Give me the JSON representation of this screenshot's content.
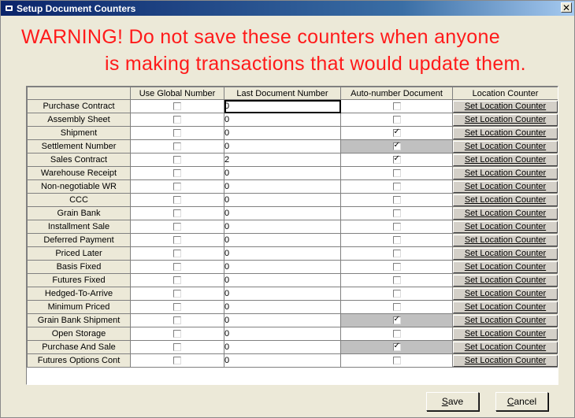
{
  "window": {
    "title": "Setup Document Counters",
    "close_glyph": "✕"
  },
  "warning": {
    "line1": "WARNING!  Do not save these counters when anyone",
    "line2": "is making transactions that would update them.",
    "color": "#ff1a1a"
  },
  "grid": {
    "columns": [
      "Use Global Number",
      "Last Document Number",
      "Auto-number Document",
      "Location Counter"
    ],
    "button_label": "Set Location Counter",
    "rows": [
      {
        "name": "Purchase Contract",
        "use_global": false,
        "last_number": "0",
        "auto_number": false,
        "shaded": false
      },
      {
        "name": "Assembly Sheet",
        "use_global": false,
        "last_number": "0",
        "auto_number": false,
        "shaded": false
      },
      {
        "name": "Shipment",
        "use_global": false,
        "last_number": "0",
        "auto_number": true,
        "shaded": false
      },
      {
        "name": "Settlement Number",
        "use_global": false,
        "last_number": "0",
        "auto_number": true,
        "shaded": true
      },
      {
        "name": "Sales Contract",
        "use_global": false,
        "last_number": "2",
        "auto_number": true,
        "shaded": false
      },
      {
        "name": "Warehouse Receipt",
        "use_global": false,
        "last_number": "0",
        "auto_number": false,
        "shaded": false
      },
      {
        "name": "Non-negotiable WR",
        "use_global": false,
        "last_number": "0",
        "auto_number": false,
        "shaded": false
      },
      {
        "name": "CCC",
        "use_global": false,
        "last_number": "0",
        "auto_number": false,
        "shaded": false
      },
      {
        "name": "Grain Bank",
        "use_global": false,
        "last_number": "0",
        "auto_number": false,
        "shaded": false
      },
      {
        "name": "Installment Sale",
        "use_global": false,
        "last_number": "0",
        "auto_number": false,
        "shaded": false
      },
      {
        "name": "Deferred Payment",
        "use_global": false,
        "last_number": "0",
        "auto_number": false,
        "shaded": false
      },
      {
        "name": "Priced Later",
        "use_global": false,
        "last_number": "0",
        "auto_number": false,
        "shaded": false
      },
      {
        "name": "Basis Fixed",
        "use_global": false,
        "last_number": "0",
        "auto_number": false,
        "shaded": false
      },
      {
        "name": "Futures Fixed",
        "use_global": false,
        "last_number": "0",
        "auto_number": false,
        "shaded": false
      },
      {
        "name": "Hedged-To-Arrive",
        "use_global": false,
        "last_number": "0",
        "auto_number": false,
        "shaded": false
      },
      {
        "name": "Minimum Priced",
        "use_global": false,
        "last_number": "0",
        "auto_number": false,
        "shaded": false
      },
      {
        "name": "Grain Bank Shipment",
        "use_global": false,
        "last_number": "0",
        "auto_number": true,
        "shaded": true
      },
      {
        "name": "Open Storage",
        "use_global": false,
        "last_number": "0",
        "auto_number": false,
        "shaded": false
      },
      {
        "name": "Purchase And Sale",
        "use_global": false,
        "last_number": "0",
        "auto_number": true,
        "shaded": true
      },
      {
        "name": "Futures Options Cont",
        "use_global": false,
        "last_number": "0",
        "auto_number": false,
        "shaded": false
      }
    ]
  },
  "buttons": {
    "save": {
      "access_key": "S",
      "rest": "ave"
    },
    "cancel": {
      "access_key": "C",
      "rest": "ancel"
    }
  }
}
